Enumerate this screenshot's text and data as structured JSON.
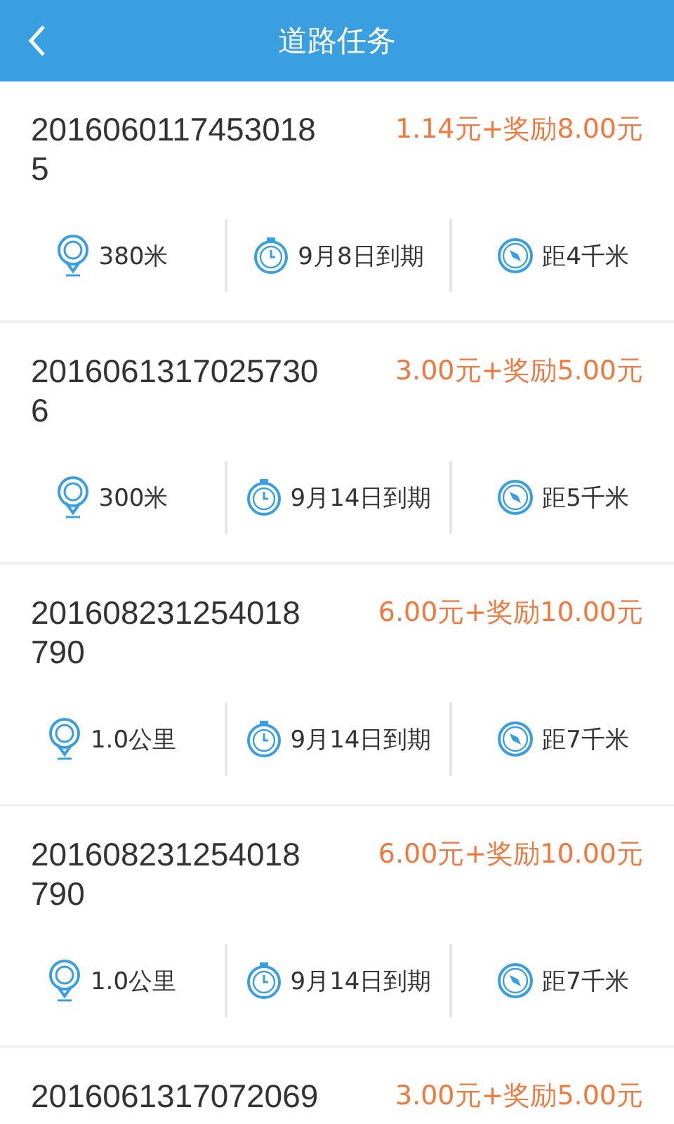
{
  "header": {
    "title": "道路任务"
  },
  "tasks": [
    {
      "id": "20160601174530185",
      "reward": "1.14元+奖励8.00元",
      "stats": [
        {
          "kind": "length",
          "text": "380米"
        },
        {
          "kind": "deadline",
          "text": "9月8日到期"
        },
        {
          "kind": "distance",
          "text": "距4千米"
        }
      ]
    },
    {
      "id": "20160613170257306",
      "reward": "3.00元+奖励5.00元",
      "stats": [
        {
          "kind": "length",
          "text": "300米"
        },
        {
          "kind": "deadline",
          "text": "9月14日到期"
        },
        {
          "kind": "distance",
          "text": "距5千米"
        }
      ]
    },
    {
      "id": "201608231254018790",
      "reward": "6.00元+奖励10.00元",
      "stats": [
        {
          "kind": "length",
          "text": "1.0公里"
        },
        {
          "kind": "deadline",
          "text": "9月14日到期"
        },
        {
          "kind": "distance",
          "text": "距7千米"
        }
      ]
    },
    {
      "id": "201608231254018790",
      "reward": "6.00元+奖励10.00元",
      "stats": [
        {
          "kind": "length",
          "text": "1.0公里"
        },
        {
          "kind": "deadline",
          "text": "9月14日到期"
        },
        {
          "kind": "distance",
          "text": "距7千米"
        }
      ]
    },
    {
      "id": "2016061317072069",
      "reward": "3.00元+奖励5.00元"
    }
  ]
}
